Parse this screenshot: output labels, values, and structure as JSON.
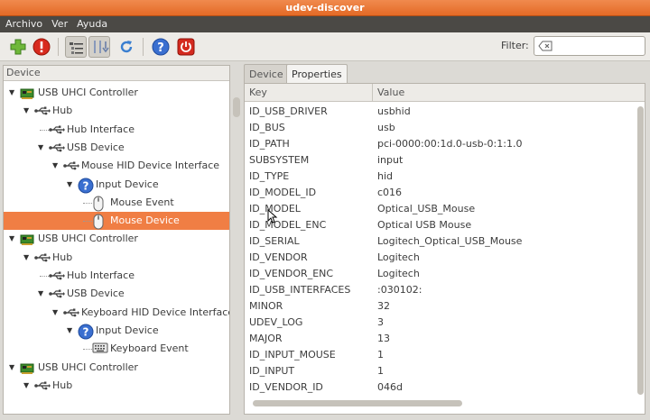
{
  "window": {
    "title": "udev-discover"
  },
  "menubar": {
    "items": [
      "Archivo",
      "Ver",
      "Ayuda"
    ]
  },
  "toolbar": {
    "buttons": [
      "add-icon",
      "alert-icon",
      "properties-view-icon",
      "hotplug-icon",
      "refresh-icon",
      "help-icon",
      "quit-icon"
    ],
    "filter_label": "Filter:",
    "filter_value": ""
  },
  "device_tree": {
    "header": "Device",
    "rows": [
      {
        "label": "USB UHCI Controller",
        "icon": "pci-card-icon",
        "expanded": true
      },
      {
        "label": "Hub",
        "icon": "usb-icon",
        "expanded": true
      },
      {
        "label": "Hub Interface",
        "icon": "usb-icon"
      },
      {
        "label": "USB Device",
        "icon": "usb-icon",
        "expanded": true
      },
      {
        "label": "Mouse HID Device Interface",
        "icon": "usb-icon",
        "expanded": true
      },
      {
        "label": "Input Device",
        "icon": "question-icon",
        "expanded": true
      },
      {
        "label": "Mouse Event",
        "icon": "mouse-icon"
      },
      {
        "label": "Mouse Device",
        "icon": "mouse-icon",
        "selected": true
      },
      {
        "label": "USB UHCI Controller",
        "icon": "pci-card-icon",
        "expanded": true
      },
      {
        "label": "Hub",
        "icon": "usb-icon",
        "expanded": true
      },
      {
        "label": "Hub Interface",
        "icon": "usb-icon"
      },
      {
        "label": "USB Device",
        "icon": "usb-icon",
        "expanded": true
      },
      {
        "label": "Keyboard HID Device Interface",
        "icon": "usb-icon",
        "expanded": true
      },
      {
        "label": "Input Device",
        "icon": "question-icon",
        "expanded": true
      },
      {
        "label": "Keyboard Event",
        "icon": "keyboard-icon"
      },
      {
        "label": "USB UHCI Controller",
        "icon": "pci-card-icon",
        "expanded": true
      },
      {
        "label": "Hub",
        "icon": "usb-icon",
        "expanded": true
      }
    ]
  },
  "tabs": [
    {
      "label": "Device",
      "active": false
    },
    {
      "label": "Properties",
      "active": true
    }
  ],
  "properties": {
    "columns": [
      "Key",
      "Value"
    ],
    "rows": [
      {
        "key": "ID_USB_DRIVER",
        "value": "usbhid"
      },
      {
        "key": "ID_BUS",
        "value": "usb"
      },
      {
        "key": "ID_PATH",
        "value": "pci-0000:00:1d.0-usb-0:1:1.0"
      },
      {
        "key": "SUBSYSTEM",
        "value": "input"
      },
      {
        "key": "ID_TYPE",
        "value": "hid"
      },
      {
        "key": "ID_MODEL_ID",
        "value": "c016"
      },
      {
        "key": "ID_MODEL",
        "value": "Optical_USB_Mouse"
      },
      {
        "key": "ID_MODEL_ENC",
        "value": "Optical USB Mouse"
      },
      {
        "key": "ID_SERIAL",
        "value": "Logitech_Optical_USB_Mouse"
      },
      {
        "key": "ID_VENDOR",
        "value": "Logitech"
      },
      {
        "key": "ID_VENDOR_ENC",
        "value": "Logitech"
      },
      {
        "key": "ID_USB_INTERFACES",
        "value": ":030102:"
      },
      {
        "key": "MINOR",
        "value": "32"
      },
      {
        "key": "UDEV_LOG",
        "value": "3"
      },
      {
        "key": "MAJOR",
        "value": "13"
      },
      {
        "key": "ID_INPUT_MOUSE",
        "value": "1"
      },
      {
        "key": "ID_INPUT",
        "value": "1"
      },
      {
        "key": "ID_VENDOR_ID",
        "value": "046d"
      }
    ]
  },
  "colors": {
    "accent": "#f07e44",
    "menubar": "#4b4945"
  }
}
